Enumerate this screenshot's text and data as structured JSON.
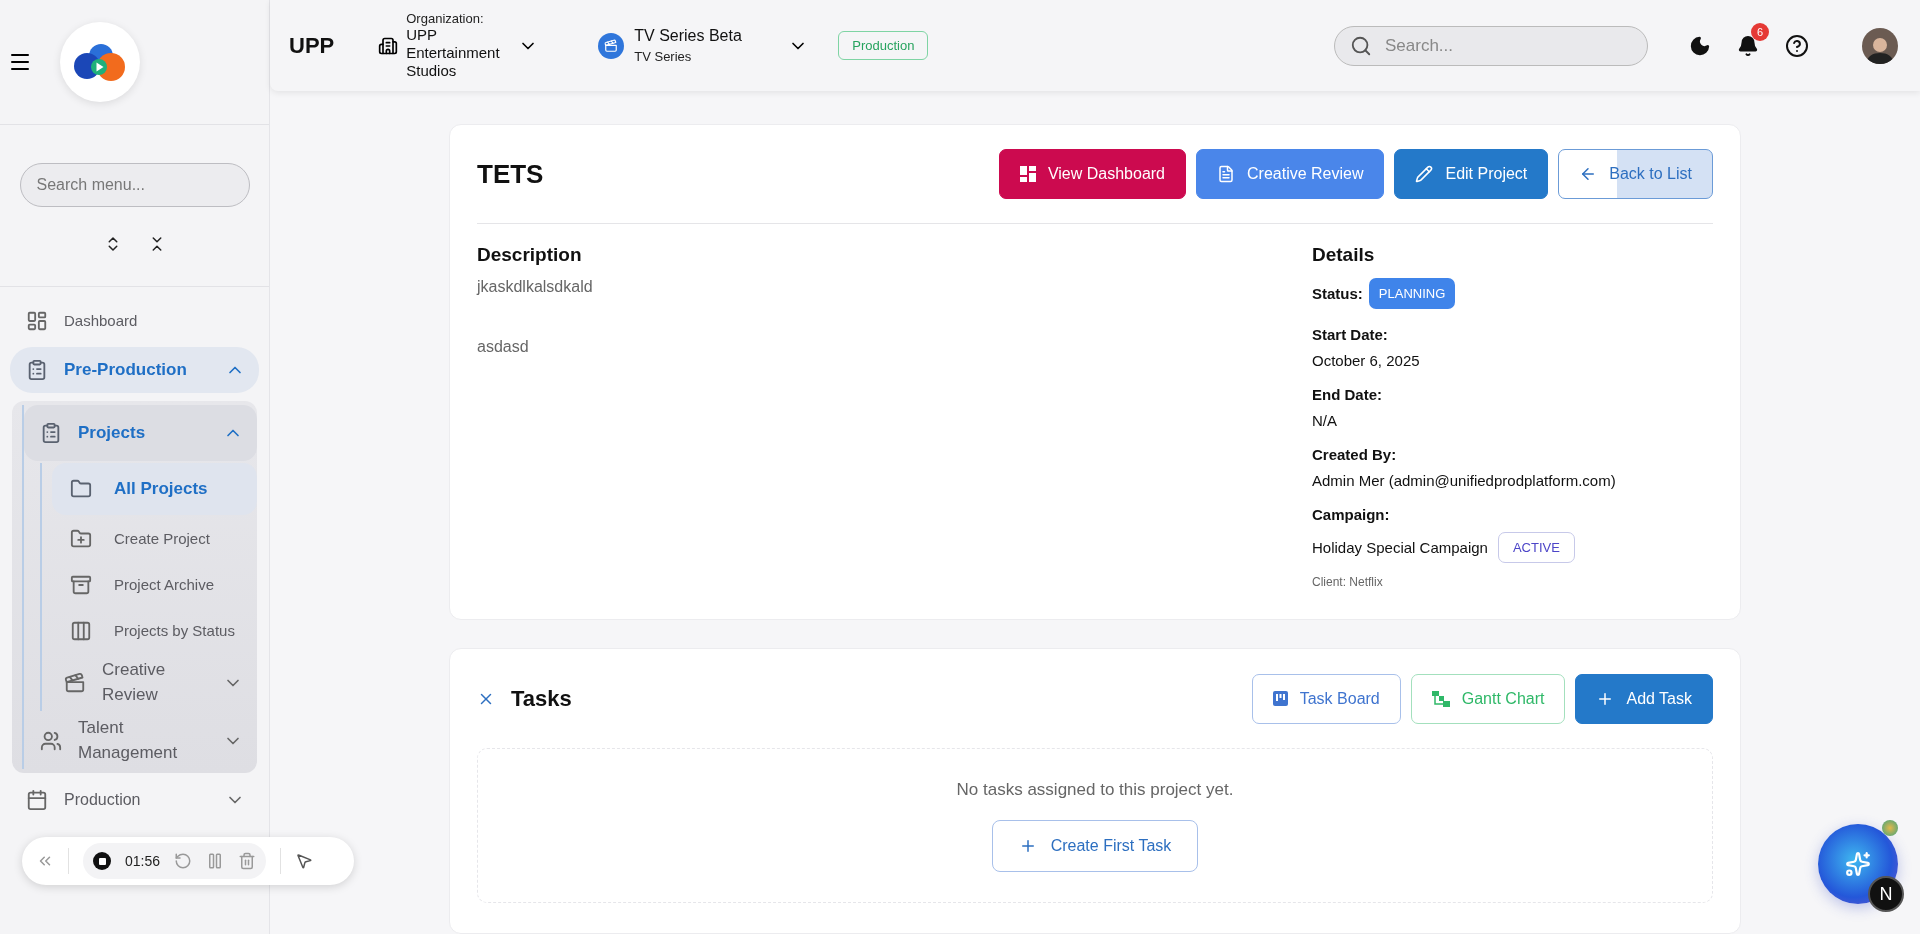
{
  "sidebar": {
    "search": {
      "placeholder": "Search menu..."
    },
    "items": [
      {
        "label": "Dashboard",
        "selected": false
      },
      {
        "label": "Pre-Production",
        "selected": true,
        "expanded": true,
        "children": [
          {
            "label": "Projects",
            "selected": true,
            "expanded": true,
            "children": [
              {
                "label": "All Projects",
                "selected": true
              },
              {
                "label": "Create Project",
                "selected": false
              },
              {
                "label": "Project Archive",
                "selected": false
              },
              {
                "label": "Projects by Status",
                "selected": false
              },
              {
                "label": "Creative Review",
                "selected": false,
                "expanded": false
              }
            ]
          },
          {
            "label": "Talent Management",
            "selected": false,
            "expanded": false
          }
        ]
      },
      {
        "label": "Production",
        "selected": false,
        "expanded": false
      }
    ]
  },
  "topbar": {
    "app_name": "UPP",
    "organization": {
      "label": "Organization:",
      "name": "UPP Entertainment Studios"
    },
    "project": {
      "title": "TV Series Beta",
      "subtitle": "TV Series"
    },
    "environment": "Production",
    "search": {
      "placeholder": "Search..."
    },
    "notifications": "6"
  },
  "project": {
    "title": "TETS",
    "actions": [
      {
        "label": "View Dashboard",
        "kind": "dashboard"
      },
      {
        "label": "Creative Review",
        "kind": "review"
      },
      {
        "label": "Edit Project",
        "kind": "edit"
      },
      {
        "label": "Back to List",
        "kind": "back"
      }
    ],
    "description": {
      "heading": "Description",
      "paragraphs": [
        "jkaskdlkalsdkald",
        "asdasd"
      ]
    },
    "details": {
      "heading": "Details",
      "status": {
        "label": "Status:",
        "value": "PLANNING"
      },
      "fields": [
        {
          "label": "Start Date:",
          "value": "October 6, 2025"
        },
        {
          "label": "End Date:",
          "value": "N/A"
        },
        {
          "label": "Created By:",
          "value": "Admin Mer (admin@unifiedprodplatform.com)"
        }
      ],
      "campaign": {
        "label": "Campaign:",
        "name": "Holiday Special Campaign",
        "status": "ACTIVE",
        "client": "Client: Netflix"
      }
    }
  },
  "tasks": {
    "title": "Tasks",
    "actions": [
      {
        "label": "Task Board",
        "kind": "board"
      },
      {
        "label": "Gantt Chart",
        "kind": "gantt"
      },
      {
        "label": "Add Task",
        "kind": "add"
      }
    ],
    "empty_message": "No tasks assigned to this project yet.",
    "create_button": "Create First Task"
  },
  "recorder": {
    "time": "01:56"
  },
  "assistant": {
    "badge": "N"
  }
}
